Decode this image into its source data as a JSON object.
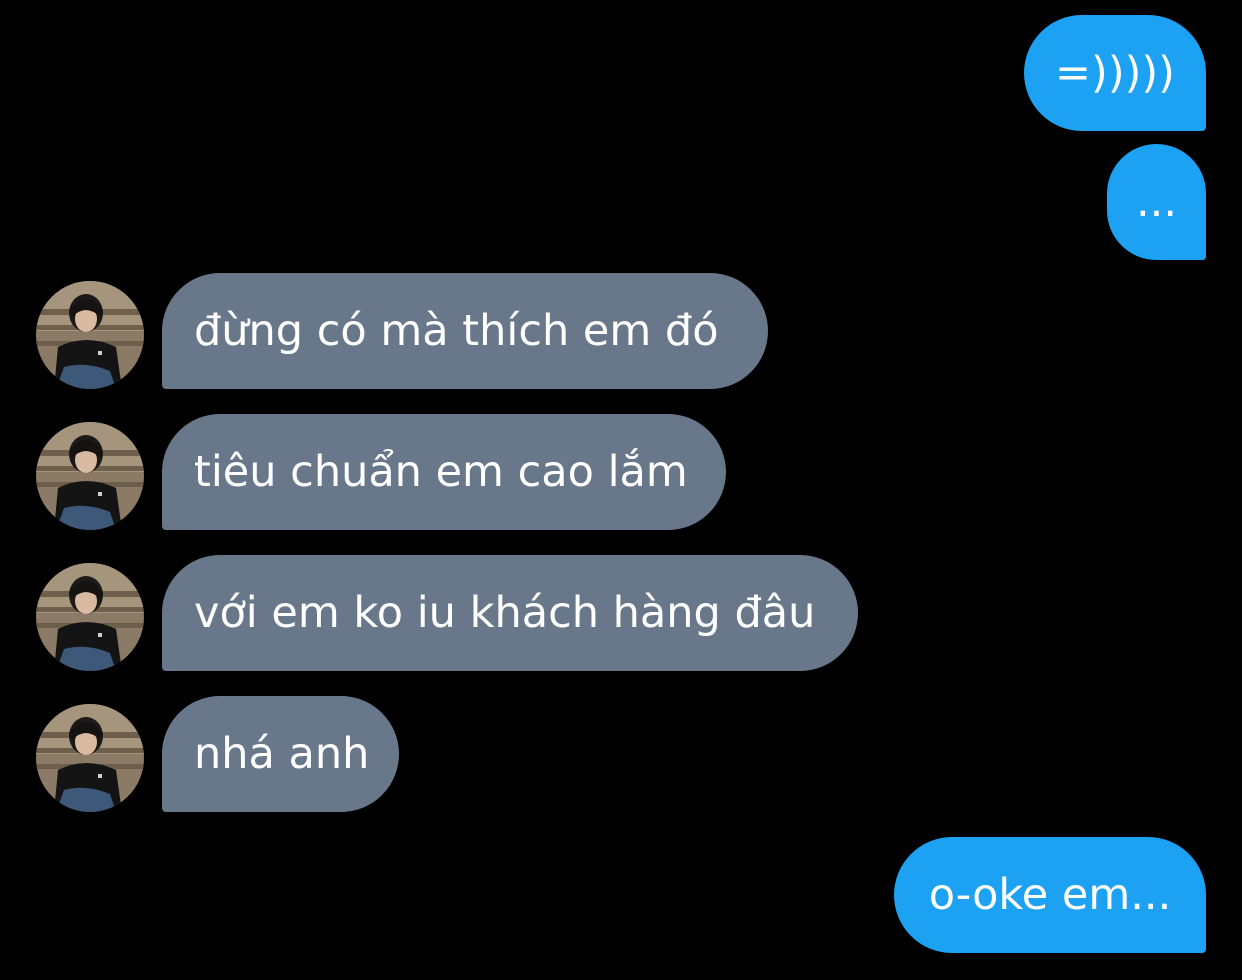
{
  "messages": [
    {
      "side": "sent",
      "text": "=)))))"
    },
    {
      "side": "sent",
      "text": "..."
    },
    {
      "side": "received",
      "text": "đừng có mà thích em đó",
      "avatar_icon": "contact-avatar"
    },
    {
      "side": "received",
      "text": "tiêu chuẩn em cao lắm",
      "avatar_icon": "contact-avatar"
    },
    {
      "side": "received",
      "text": "với em ko iu khách hàng đâu",
      "avatar_icon": "contact-avatar"
    },
    {
      "side": "received",
      "text": "nhá anh",
      "avatar_icon": "contact-avatar"
    },
    {
      "side": "sent",
      "text": "o-oke em..."
    }
  ],
  "colors": {
    "background": "#000000",
    "sent_bubble": "#1da1f2",
    "received_bubble": "#68788a",
    "text": "#ffffff"
  }
}
